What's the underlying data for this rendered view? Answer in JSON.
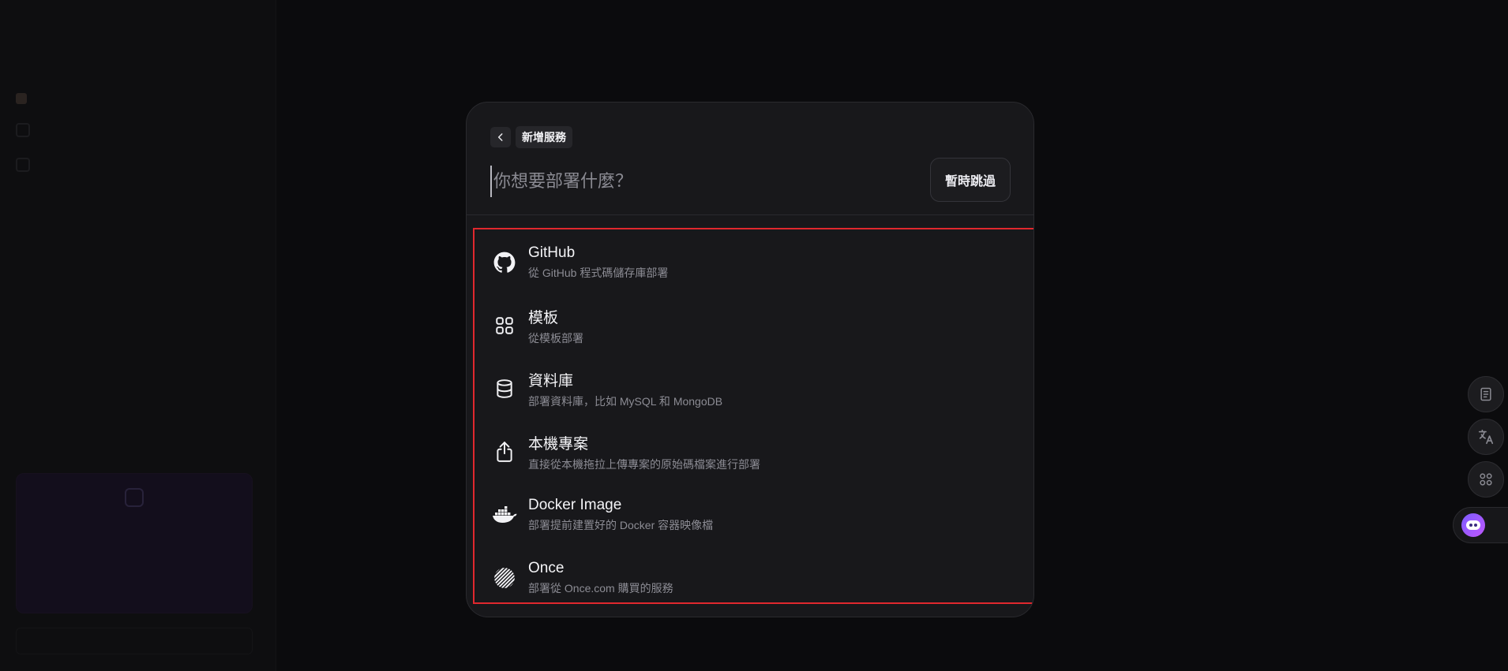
{
  "modal": {
    "title": "新增服務",
    "search_placeholder": "你想要部署什麼？",
    "skip_label": "暫時跳過",
    "options": [
      {
        "title": "GitHub",
        "desc": "從 GitHub 程式碼儲存庫部署",
        "icon": "github-icon"
      },
      {
        "title": "模板",
        "desc": "從模板部署",
        "icon": "template-grid-icon"
      },
      {
        "title": "資料庫",
        "desc": "部署資料庫，比如 MySQL 和 MongoDB",
        "icon": "database-icon"
      },
      {
        "title": "本機專案",
        "desc": "直接從本機拖拉上傳專案的原始碼檔案進行部署",
        "icon": "upload-icon"
      },
      {
        "title": "Docker Image",
        "desc": "部署提前建置好的 Docker 容器映像檔",
        "icon": "docker-icon"
      },
      {
        "title": "Once",
        "desc": "部署從 Once.com 購買的服務",
        "icon": "once-icon"
      }
    ]
  },
  "toolbar": {
    "icons": [
      "notes-icon",
      "translate-icon",
      "apps-icon",
      "assistant-icon"
    ]
  }
}
